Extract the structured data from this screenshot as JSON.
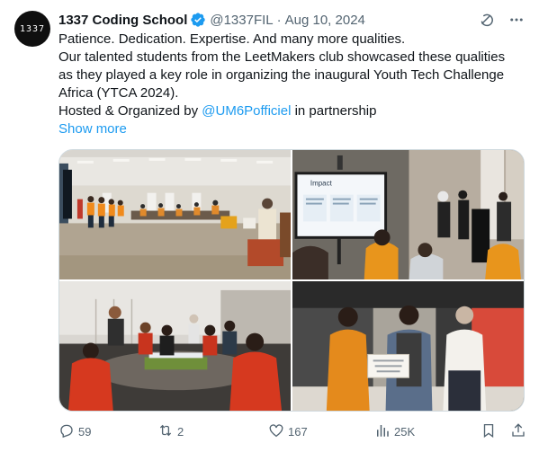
{
  "author": {
    "avatar_text": "1337",
    "name": "1337 Coding School",
    "handle": "@1337FIL",
    "separator": "·",
    "date": "Aug 10, 2024",
    "verified": true
  },
  "tweet": {
    "line1": "Patience. Dedication. Expertise. And many more qualities.",
    "line2": "Our talented students from the LeetMakers club showcased these qualities",
    "line3": "as they played a key role in organizing the inaugural Youth Tech Challenge",
    "line4": "Africa (YTCA 2024).",
    "line5_prefix": "Hosted & Organized by ",
    "mention": "@UM6Pofficiel",
    "line5_suffix": " in partnership",
    "show_more": "Show more"
  },
  "photo_slide": {
    "title": "Impact"
  },
  "actions": {
    "reply_count": "59",
    "retweet_count": "2",
    "like_count": "167",
    "views_count": "25K"
  },
  "icons": {
    "verified": "verified-badge-icon",
    "grok": "grok-icon",
    "more": "more-icon",
    "reply": "reply-icon",
    "retweet": "retweet-icon",
    "like": "heart-icon",
    "views": "views-icon",
    "bookmark": "bookmark-icon",
    "share": "share-icon"
  },
  "colors": {
    "link": "#1d9bf0",
    "muted": "#536471",
    "text": "#0f1419"
  }
}
